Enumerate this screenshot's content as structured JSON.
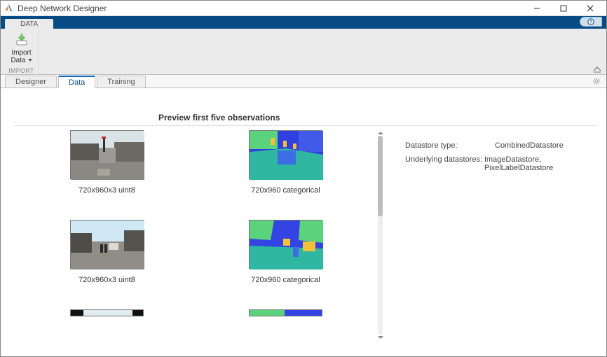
{
  "window": {
    "title": "Deep Network Designer"
  },
  "ribbon": {
    "tab": "DATA",
    "import_label_1": "Import",
    "import_label_2": "Data",
    "group_label": "IMPORT"
  },
  "tabs": {
    "designer": "Designer",
    "data": "Data",
    "training": "Training"
  },
  "preview": {
    "heading": "Preview first five observations",
    "img_caption": "720x960x3 uint8",
    "seg_caption": "720x960 categorical"
  },
  "info": {
    "type_label": "Datastore type:",
    "type_value": "CombinedDatastore",
    "underlying_label": "Underlying datastores:",
    "underlying_value": "ImageDatastore, PixelLabelDatastore"
  }
}
